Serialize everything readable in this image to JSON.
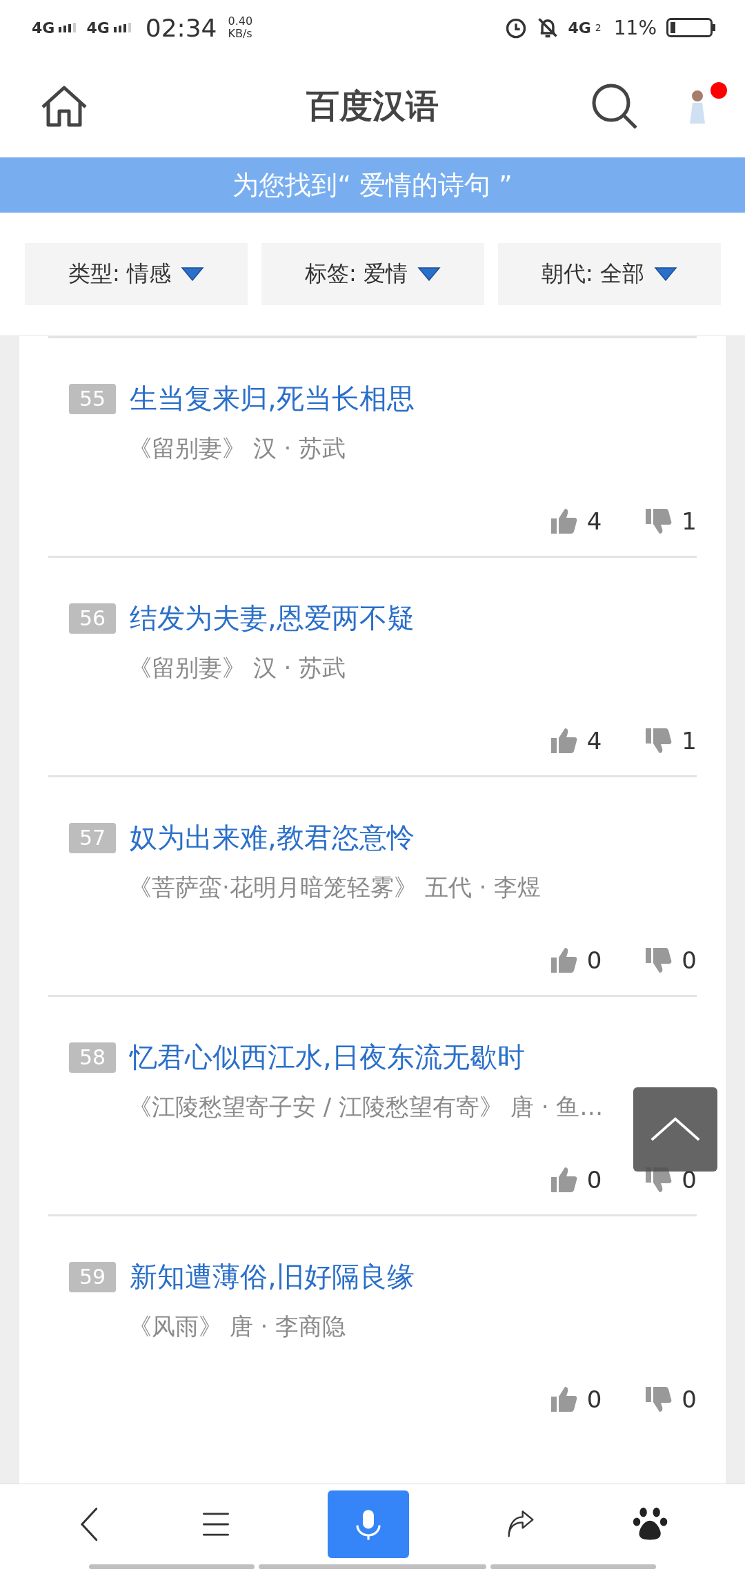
{
  "status_bar": {
    "network_1": "4G",
    "network_2": "4G",
    "time": "02:34",
    "speed": "0.40",
    "speed_unit": "KB/s",
    "mobile": "4G",
    "sim": "2",
    "battery": "11%"
  },
  "header": {
    "title": "百度汉语",
    "notification": true
  },
  "banner": "为您找到“ 爱情的诗句 ”",
  "filters": [
    {
      "label": "类型: 情感"
    },
    {
      "label": "标签: 爱情"
    },
    {
      "label": "朝代: 全部"
    }
  ],
  "poems": [
    {
      "number": "55",
      "title": "生当复来归,死当长相思",
      "source": "《留别妻》 汉 · 苏武",
      "likes": "4",
      "dislikes": "1"
    },
    {
      "number": "56",
      "title": "结发为夫妻,恩爱两不疑",
      "source": "《留别妻》 汉 · 苏武",
      "likes": "4",
      "dislikes": "1"
    },
    {
      "number": "57",
      "title": "奴为出来难,教君恣意怜",
      "source": "《菩萨蛮·花明月暗笼轻雾》 五代 · 李煜",
      "likes": "0",
      "dislikes": "0"
    },
    {
      "number": "58",
      "title": "忆君心似西江水,日夜东流无歇时",
      "source": "《江陵愁望寄子安 / 江陵愁望有寄》 唐 · 鱼…",
      "likes": "0",
      "dislikes": "0"
    },
    {
      "number": "59",
      "title": "新知遭薄俗,旧好隔良缘",
      "source": "《风雨》 唐 · 李商隐",
      "likes": "0",
      "dislikes": "0"
    }
  ]
}
